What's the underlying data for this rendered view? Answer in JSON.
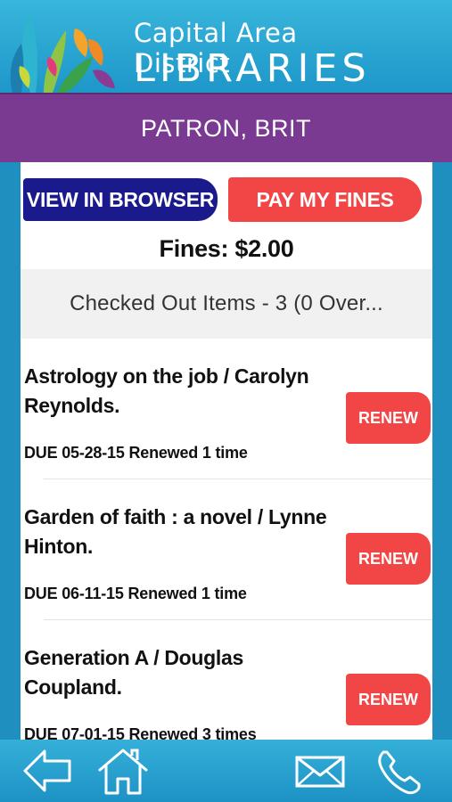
{
  "header": {
    "brand_line1": "Capital Area District",
    "brand_line2": "LIBRARIES",
    "logo_icon": "cadl-logo-icon"
  },
  "patron": {
    "name": "PATRON, BRIT"
  },
  "buttons": {
    "view_in_browser": "VIEW IN BROWSER",
    "pay_my_fines": "PAY MY FINES"
  },
  "fines_text": "Fines: $2.00",
  "section_header": "Checked Out Items - 3 (0 Over...",
  "items": [
    {
      "title": "Astrology on the job / Carolyn Reynolds.",
      "due": "DUE 05-28-15 Renewed 1 time",
      "action": "RENEW"
    },
    {
      "title": "Garden of faith : a novel / Lynne Hinton.",
      "due": "DUE 06-11-15 Renewed 1 time",
      "action": "RENEW"
    },
    {
      "title": "Generation A / Douglas Coupland.",
      "due": "DUE 07-01-15 Renewed 3 times",
      "action": "RENEW"
    }
  ],
  "bottom_nav": {
    "icons": [
      "back-arrow-icon",
      "home-icon",
      "mail-icon",
      "phone-icon"
    ]
  },
  "colors": {
    "header_blue": "#1e97c9",
    "patron_purple": "#7a3a92",
    "browser_button_navy": "#1a1a8c",
    "action_red": "#f24646"
  }
}
